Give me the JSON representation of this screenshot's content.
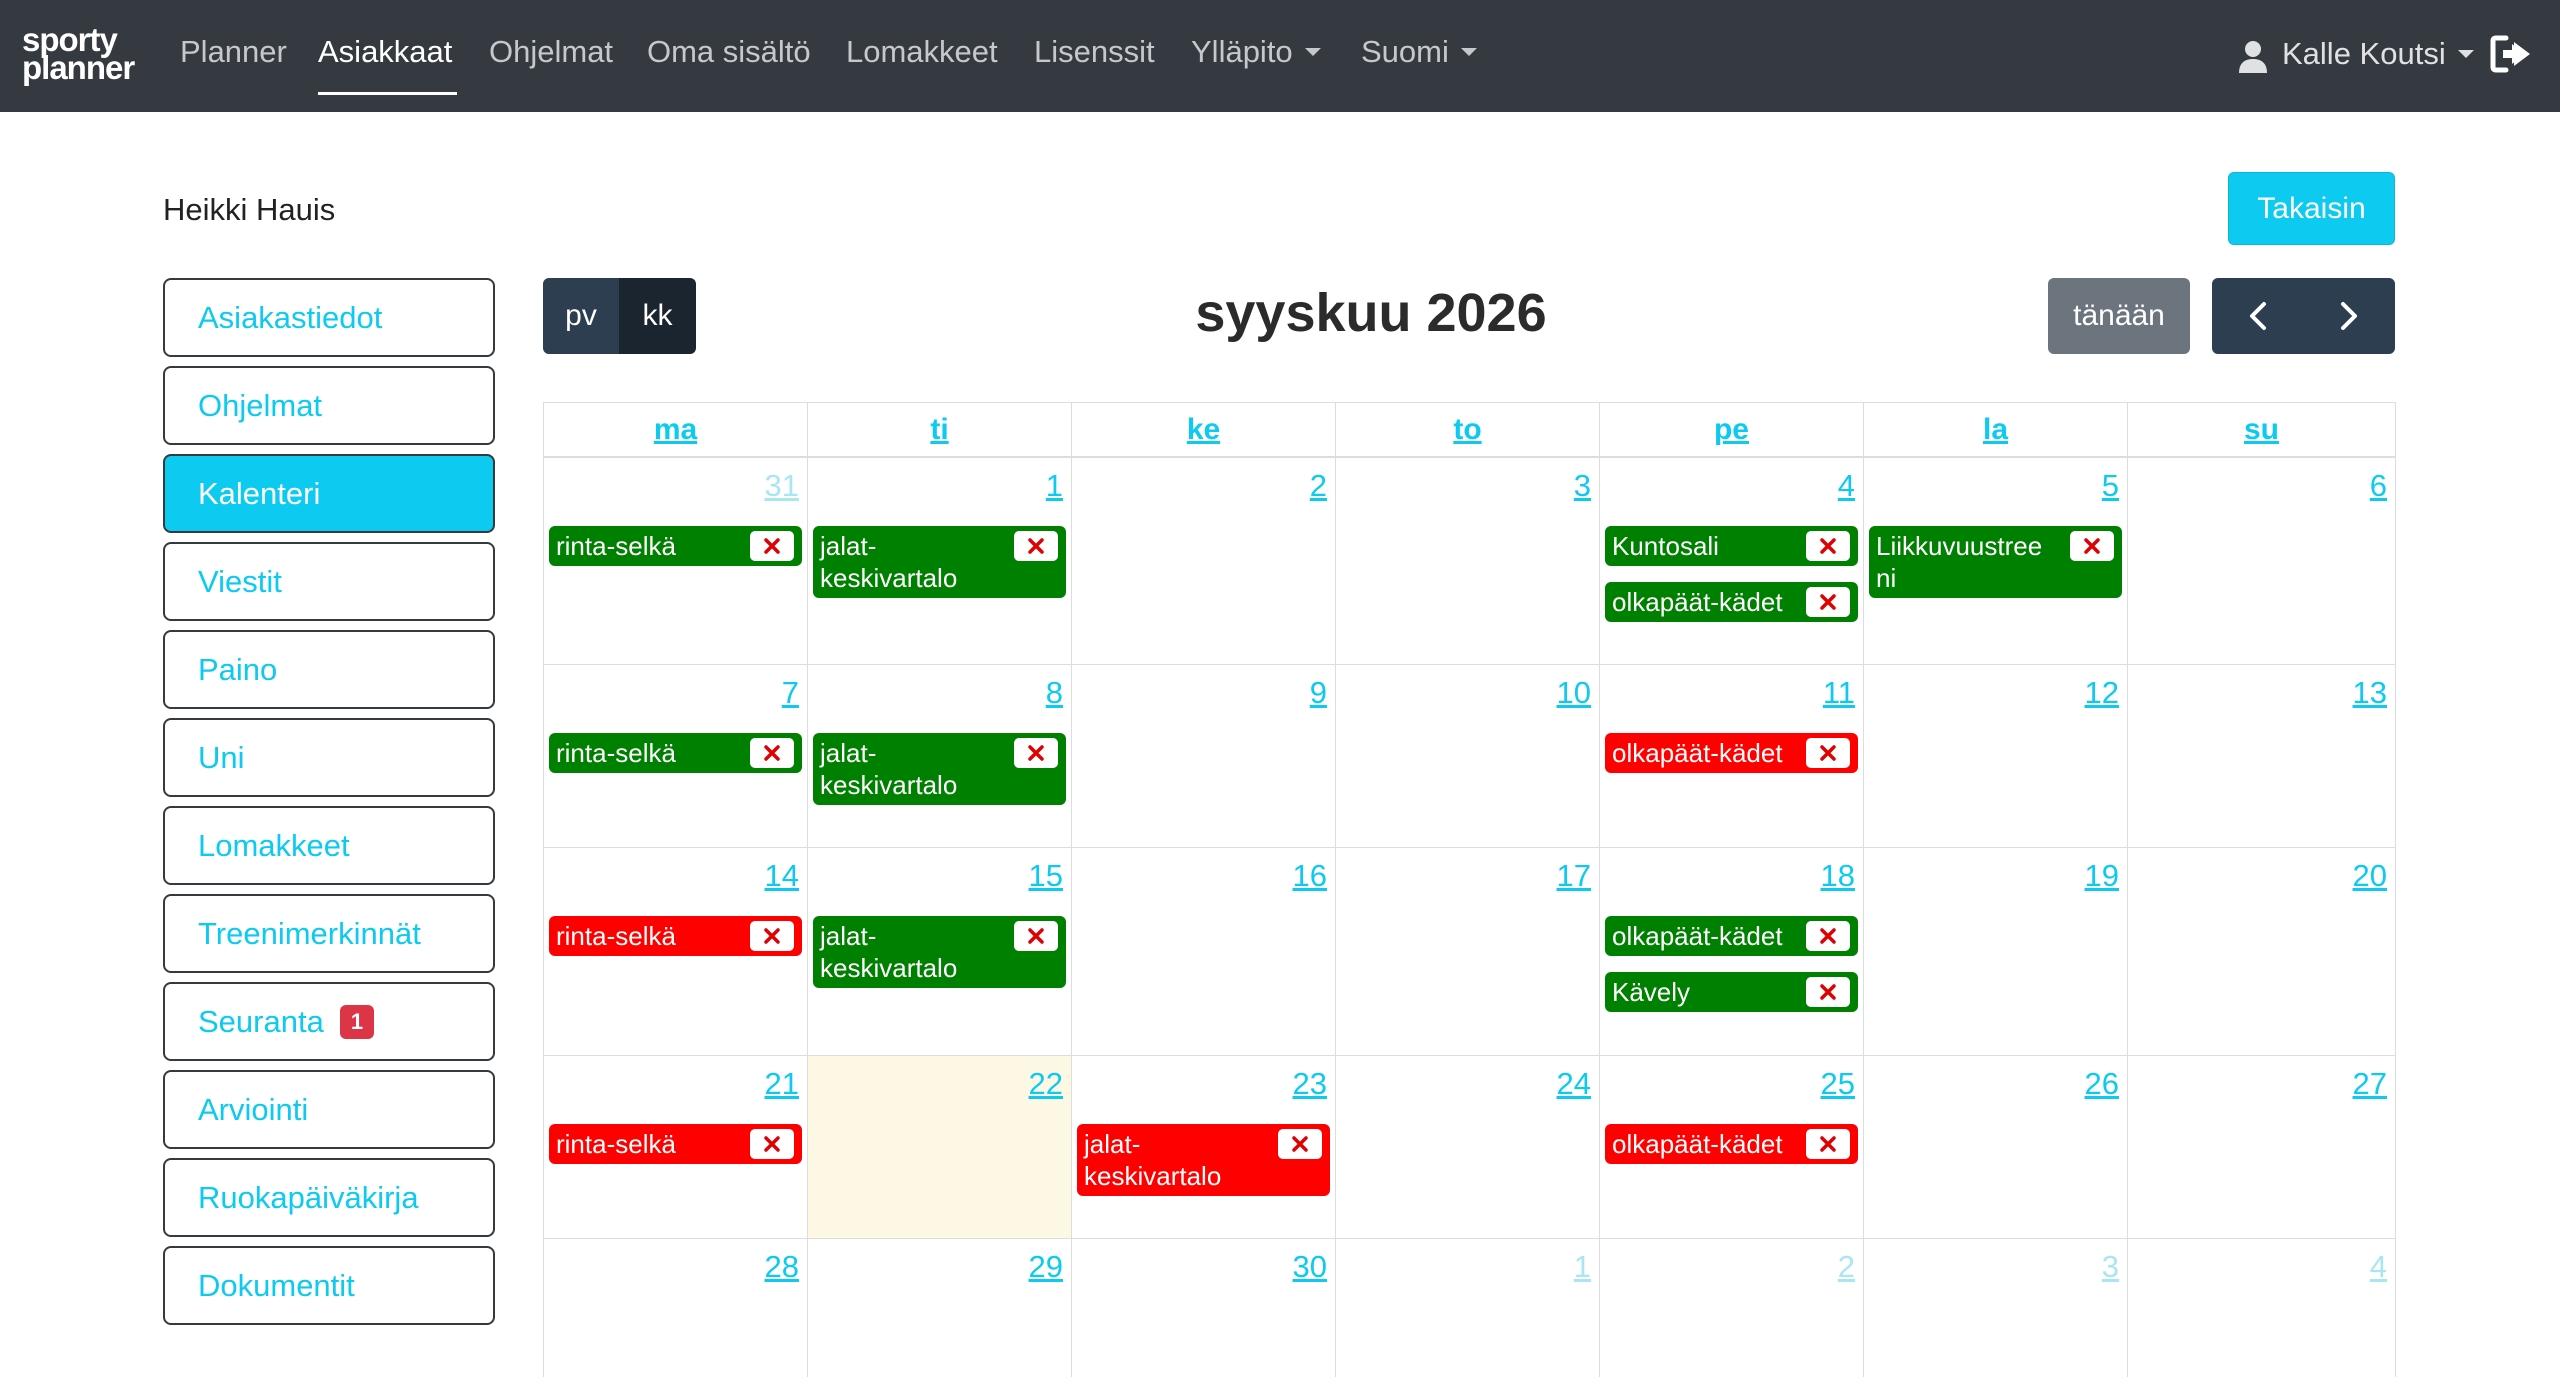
{
  "navbar": {
    "logo_line1": "sporty",
    "logo_line2": "planner",
    "items": [
      "Planner",
      "Asiakkaat",
      "Ohjelmat",
      "Oma sisältö",
      "Lomakkeet",
      "Lisenssit",
      "Ylläpito",
      "Suomi"
    ],
    "active_item": "Asiakkaat",
    "user_name": "Kalle Koutsi"
  },
  "client": {
    "name": "Heikki Hauis",
    "back_label": "Takaisin"
  },
  "sidebar": {
    "items": [
      {
        "label": "Asiakastiedot"
      },
      {
        "label": "Ohjelmat"
      },
      {
        "label": "Kalenteri",
        "active": true
      },
      {
        "label": "Viestit"
      },
      {
        "label": "Paino"
      },
      {
        "label": "Uni"
      },
      {
        "label": "Lomakkeet"
      },
      {
        "label": "Treenimerkinnät"
      },
      {
        "label": "Seuranta",
        "badge": "1"
      },
      {
        "label": "Arviointi"
      },
      {
        "label": "Ruokapäiväkirja"
      },
      {
        "label": "Dokumentit"
      }
    ]
  },
  "calendar": {
    "title": "syyskuu 2026",
    "view_day": "pv",
    "view_month": "kk",
    "today_label": "tänään",
    "weekdays": [
      "ma",
      "ti",
      "ke",
      "to",
      "pe",
      "la",
      "su"
    ],
    "colors": {
      "done": "#008000",
      "missed": "#ff0000",
      "today_bg": "#fcf8e3",
      "accent": "#0dcaf0"
    },
    "weeks": [
      {
        "days": [
          {
            "num": "31",
            "other": true,
            "events": [
              {
                "title": "rinta-selkä",
                "status": "done"
              }
            ]
          },
          {
            "num": "1",
            "events": [
              {
                "title": "jalat-keskivartalo",
                "status": "done",
                "lines": [
                  "jalat-",
                  "keskivartalo"
                ]
              }
            ]
          },
          {
            "num": "2",
            "events": []
          },
          {
            "num": "3",
            "events": []
          },
          {
            "num": "4",
            "events": [
              {
                "title": "Kuntosali",
                "status": "done"
              },
              {
                "title": "olkapäät-kädet",
                "status": "done"
              }
            ]
          },
          {
            "num": "5",
            "events": [
              {
                "title": "Liikkuvuustreeni",
                "status": "done",
                "lines": [
                  "Liikkuvuustree",
                  "ni"
                ]
              }
            ]
          },
          {
            "num": "6",
            "events": []
          }
        ]
      },
      {
        "days": [
          {
            "num": "7",
            "events": [
              {
                "title": "rinta-selkä",
                "status": "done"
              }
            ]
          },
          {
            "num": "8",
            "events": [
              {
                "title": "jalat-keskivartalo",
                "status": "done",
                "lines": [
                  "jalat-",
                  "keskivartalo"
                ]
              }
            ]
          },
          {
            "num": "9",
            "events": []
          },
          {
            "num": "10",
            "events": []
          },
          {
            "num": "11",
            "events": [
              {
                "title": "olkapäät-kädet",
                "status": "missed"
              }
            ]
          },
          {
            "num": "12",
            "events": []
          },
          {
            "num": "13",
            "events": []
          }
        ]
      },
      {
        "days": [
          {
            "num": "14",
            "events": [
              {
                "title": "rinta-selkä",
                "status": "missed"
              }
            ]
          },
          {
            "num": "15",
            "events": [
              {
                "title": "jalat-keskivartalo",
                "status": "done",
                "lines": [
                  "jalat-",
                  "keskivartalo"
                ]
              }
            ]
          },
          {
            "num": "16",
            "events": []
          },
          {
            "num": "17",
            "events": []
          },
          {
            "num": "18",
            "events": [
              {
                "title": "olkapäät-kädet",
                "status": "done"
              },
              {
                "title": "Kävely",
                "status": "done"
              }
            ]
          },
          {
            "num": "19",
            "events": []
          },
          {
            "num": "20",
            "events": []
          }
        ]
      },
      {
        "days": [
          {
            "num": "21",
            "events": [
              {
                "title": "rinta-selkä",
                "status": "missed"
              }
            ]
          },
          {
            "num": "22",
            "today": true,
            "events": []
          },
          {
            "num": "23",
            "events": [
              {
                "title": "jalat-keskivartalo",
                "status": "missed",
                "lines": [
                  "jalat-",
                  "keskivartalo"
                ]
              }
            ]
          },
          {
            "num": "24",
            "events": []
          },
          {
            "num": "25",
            "events": [
              {
                "title": "olkapäät-kädet",
                "status": "missed"
              }
            ]
          },
          {
            "num": "26",
            "events": []
          },
          {
            "num": "27",
            "events": []
          }
        ]
      },
      {
        "days": [
          {
            "num": "28",
            "events": []
          },
          {
            "num": "29",
            "events": []
          },
          {
            "num": "30",
            "events": []
          },
          {
            "num": "1",
            "other": true,
            "events": []
          },
          {
            "num": "2",
            "other": true,
            "events": []
          },
          {
            "num": "3",
            "other": true,
            "events": []
          },
          {
            "num": "4",
            "other": true,
            "events": []
          }
        ]
      }
    ]
  }
}
